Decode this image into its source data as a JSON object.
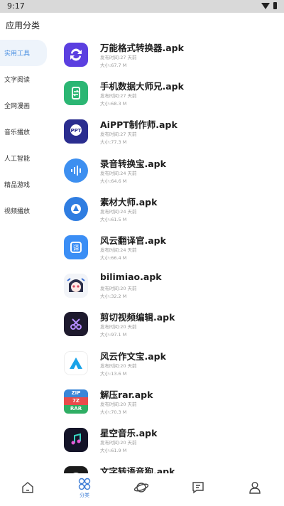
{
  "status_bar": {
    "time": "9:17"
  },
  "page": {
    "title": "应用分类"
  },
  "sidebar": {
    "items": [
      {
        "label": "实用工具",
        "active": true
      },
      {
        "label": "文字阅读",
        "active": false
      },
      {
        "label": "全网漫画",
        "active": false
      },
      {
        "label": "音乐播放",
        "active": false
      },
      {
        "label": "人工智能",
        "active": false
      },
      {
        "label": "精品游戏",
        "active": false
      },
      {
        "label": "视频播放",
        "active": false
      }
    ]
  },
  "apps": [
    {
      "name": "万能格式转换器.apk",
      "date": "发布时间:27 天前",
      "size": "大小:67.7 M",
      "icon": "convert-icon"
    },
    {
      "name": "手机数据大师兄.apk",
      "date": "发布时间:27 天前",
      "size": "大小:68.3 M",
      "icon": "phone-transfer-icon"
    },
    {
      "name": "AiPPT制作师.apk",
      "date": "发布时间:27 天前",
      "size": "大小:77.3 M",
      "icon": "ppt-icon"
    },
    {
      "name": "录音转换宝.apk",
      "date": "发布时间:24 天前",
      "size": "大小:64.6 M",
      "icon": "voice-wave-icon"
    },
    {
      "name": "素材大师.apk",
      "date": "发布时间:24 天前",
      "size": "大小:61.5 M",
      "icon": "material-icon"
    },
    {
      "name": "风云翻译官.apk",
      "date": "发布时间:24 天前",
      "size": "大小:66.4 M",
      "icon": "translate-icon"
    },
    {
      "name": "bilimiao.apk",
      "date": "发布时间:20 天前",
      "size": "大小:32.2 M",
      "icon": "anime-face-icon"
    },
    {
      "name": "剪切视频编辑.apk",
      "date": "发布时间:20 天前",
      "size": "大小:97.1 M",
      "icon": "scissors-icon"
    },
    {
      "name": "风云作文宝.apk",
      "date": "发布时间:20 天前",
      "size": "大小:13.6 M",
      "icon": "triangle-logo-icon"
    },
    {
      "name": "解压rar.apk",
      "date": "发布时间:20 天前",
      "size": "大小:70.3 M",
      "icon": "zip-icon",
      "icon_text": [
        "ZIP",
        "7Z",
        "RAR"
      ]
    },
    {
      "name": "星空音乐.apk",
      "date": "发布时间:20 天前",
      "size": "大小:61.9 M",
      "icon": "music-note-icon"
    },
    {
      "name": "文字转语音狗.apk",
      "date": "",
      "size": "",
      "icon": "text-to-speech-icon"
    }
  ],
  "tabbar": {
    "items": [
      {
        "icon": "home-icon",
        "label": ""
      },
      {
        "icon": "category-icon",
        "label": "分类",
        "active": true
      },
      {
        "icon": "planet-icon",
        "label": ""
      },
      {
        "icon": "message-icon",
        "label": ""
      },
      {
        "icon": "user-icon",
        "label": ""
      }
    ]
  },
  "colors": {
    "accent": "#4a90e2",
    "active_bg": "#eef4fb"
  }
}
